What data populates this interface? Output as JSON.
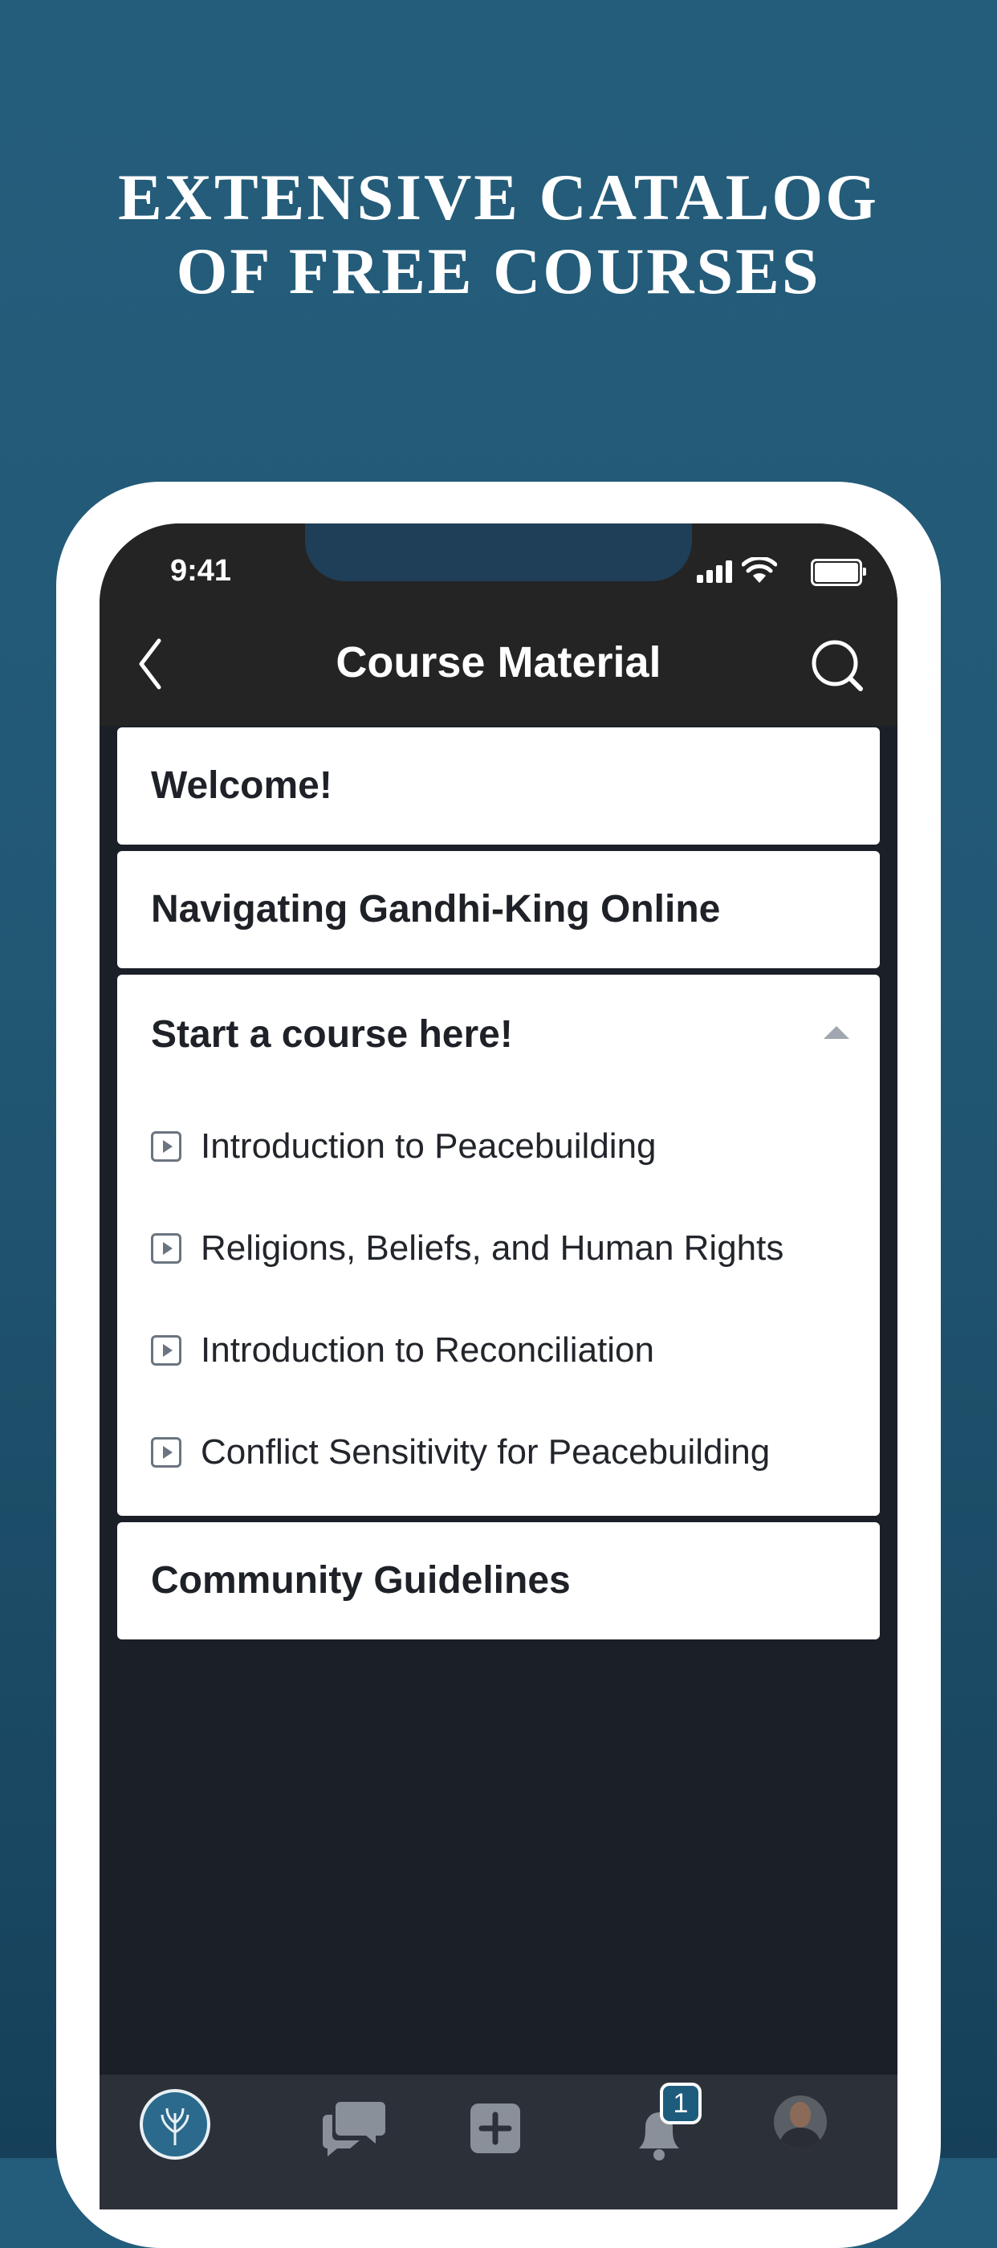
{
  "marketing": {
    "headline_line1": "EXTENSIVE CATALOG",
    "headline_line2": "OF FREE COURSES"
  },
  "status_bar": {
    "time": "9:41"
  },
  "nav": {
    "title": "Course Material",
    "back_icon": "chevron-left-icon",
    "search_icon": "search-icon"
  },
  "sections": [
    {
      "title": "Welcome!"
    },
    {
      "title": "Navigating Gandhi-King Online"
    },
    {
      "title": "Start a course here!",
      "expanded": true,
      "items": [
        "Introduction to Peacebuilding",
        "Religions, Beliefs, and Human Rights",
        "Introduction to Reconciliation",
        "Conflict Sensitivity for Peacebuilding"
      ]
    },
    {
      "title": "Community Guidelines"
    }
  ],
  "tabbar": {
    "tabs": [
      "home-logo-icon",
      "chat-icon",
      "add-icon",
      "notifications-icon",
      "profile-avatar"
    ],
    "notification_count": "1"
  },
  "colors": {
    "background_top": "#245d7c",
    "background_bottom": "#16405a",
    "nav_bar": "#242424",
    "screen_bg": "#1b1f27",
    "card_bg": "#ffffff",
    "accent": "#1e5c7d"
  }
}
